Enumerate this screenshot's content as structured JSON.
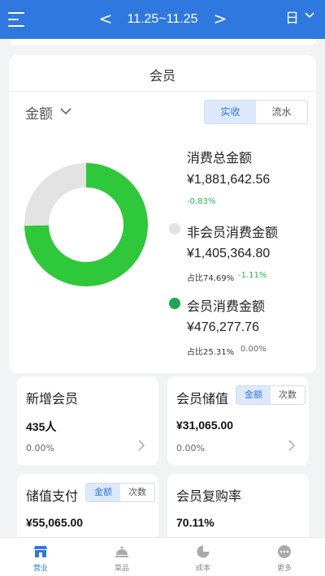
{
  "header": {
    "prev": "<",
    "date_range": "11.25~11.25",
    "next": ">",
    "period": "日"
  },
  "member_card": {
    "title": "会员",
    "metric": "金额",
    "tabs": [
      {
        "label": "实收",
        "active": true
      },
      {
        "label": "流水",
        "active": false
      }
    ],
    "donut": {
      "member_share": 0.2531,
      "colors": {
        "member": "#2fc83a",
        "non_member": "#e3e3e3"
      }
    },
    "total": {
      "label": "消费总金额",
      "value": "¥1,881,642.56",
      "change": "-0.83%"
    },
    "non_member": {
      "label": "非会员消费金额",
      "value": "¥1,405,364.80",
      "share": "占比74.69%",
      "change": "-1.11%"
    },
    "member": {
      "label": "会员消费金额",
      "value": "¥476,277.76",
      "share": "占比25.31%",
      "change": "0.00%"
    }
  },
  "stats": {
    "new_members": {
      "title": "新增会员",
      "value": "435人",
      "pct": "0.00%"
    },
    "member_deposit": {
      "title": "会员储值",
      "value": "¥31,065.00",
      "pct": "0.00%",
      "tabs": [
        "金额",
        "次数"
      ]
    },
    "deposit_payment": {
      "title": "储值支付",
      "value": "¥55,065.00",
      "tabs": [
        "金额",
        "次数"
      ]
    },
    "repurchase_rate": {
      "title": "会员复购率",
      "value": "70.11%"
    }
  },
  "nav": {
    "items": [
      {
        "label": "营业",
        "icon": "store-icon",
        "active": true
      },
      {
        "label": "菜品",
        "icon": "cloche-icon",
        "active": false
      },
      {
        "label": "成本",
        "icon": "pie-chart-icon",
        "active": false
      },
      {
        "label": "更多",
        "icon": "more-icon",
        "active": false
      }
    ]
  },
  "colors": {
    "accent": "#2f78e0",
    "positive": "#21b44a"
  }
}
